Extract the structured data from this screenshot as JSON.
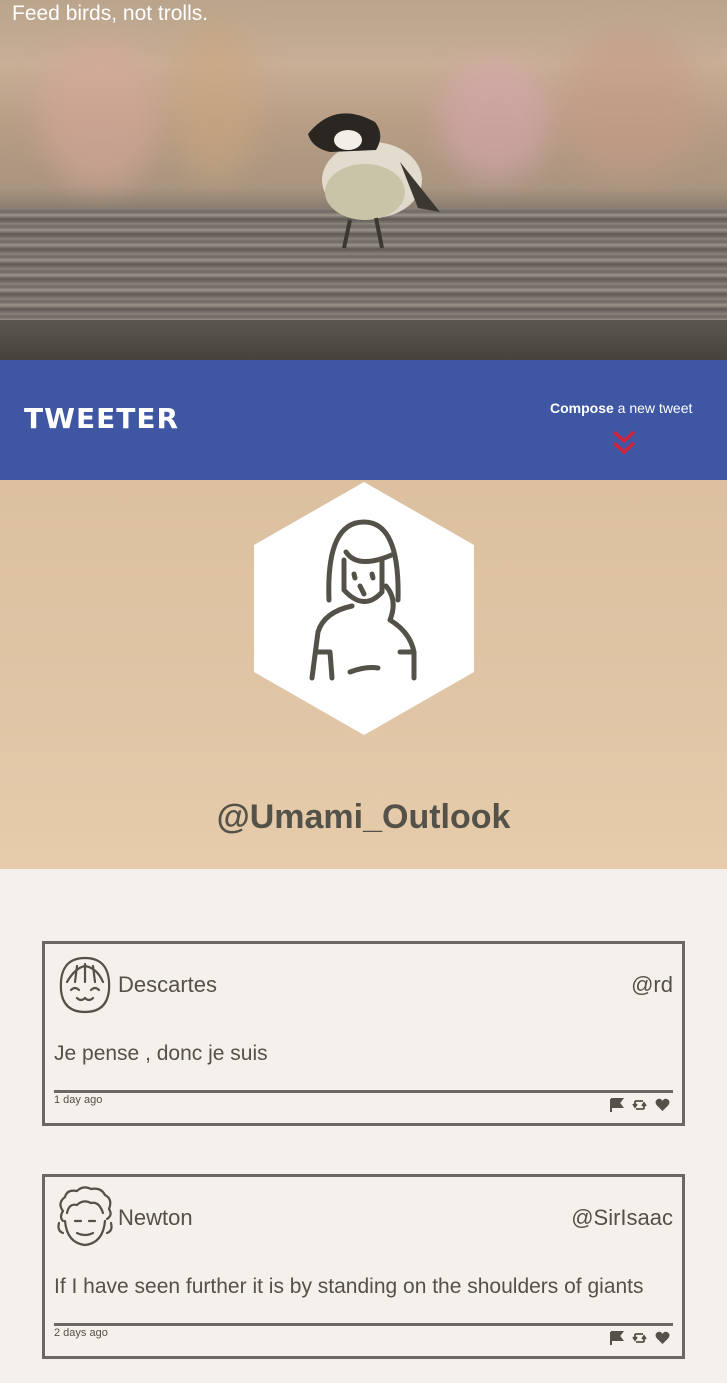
{
  "hero": {
    "tagline": "Feed birds, not trolls."
  },
  "header": {
    "logo": "TWEETER",
    "compose_bold": "Compose",
    "compose_rest": " a new tweet",
    "compose_icon": "double-chevron-down-icon",
    "accent_color": "#3f56a3",
    "arrow_color": "#d0243a"
  },
  "profile": {
    "handle": "@Umami_Outlook",
    "avatar_icon": "woman-avatar-icon"
  },
  "tweets": [
    {
      "name": "Descartes",
      "handle": "@rd",
      "content": "Je pense , donc je suis",
      "time": "1 day ago",
      "avatar_icon": "smiling-person-avatar-icon",
      "actions": [
        "flag-icon",
        "retweet-icon",
        "heart-icon"
      ]
    },
    {
      "name": "Newton",
      "handle": "@SirIsaac",
      "content": "If I have seen further it is by standing on the shoulders of giants",
      "time": "2 days ago",
      "avatar_icon": "curly-hair-person-avatar-icon",
      "actions": [
        "flag-icon",
        "retweet-icon",
        "heart-icon"
      ]
    }
  ]
}
